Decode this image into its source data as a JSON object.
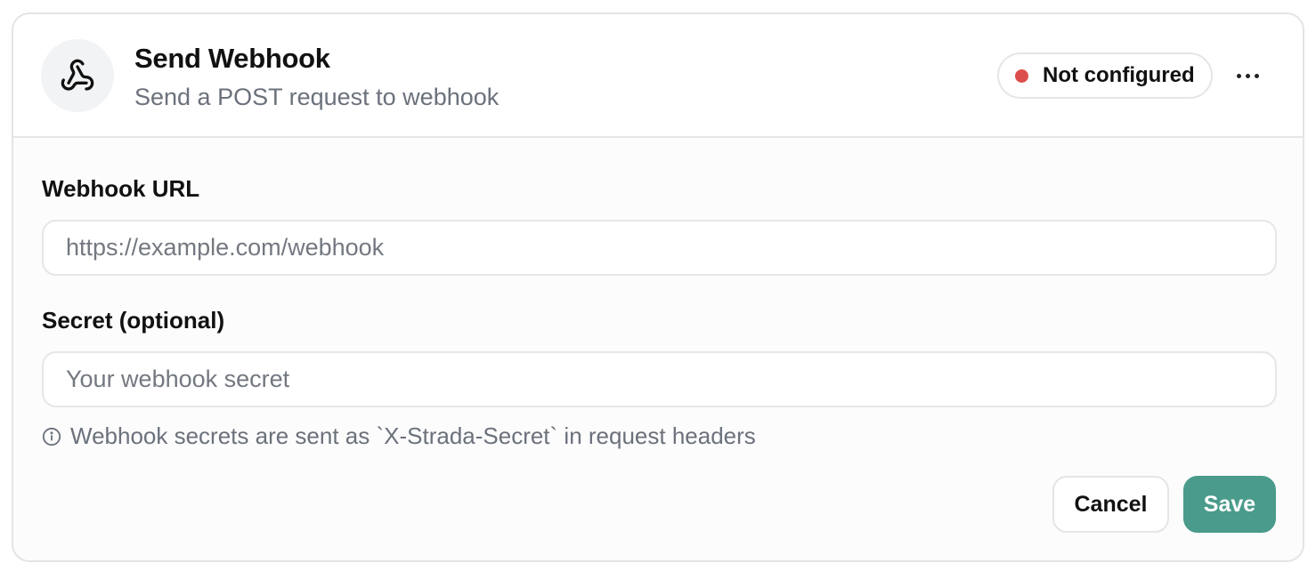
{
  "header": {
    "icon": "webhook-icon",
    "title": "Send Webhook",
    "subtitle": "Send a POST request to webhook",
    "status": {
      "label": "Not configured",
      "color": "#dc4e4e"
    },
    "more_icon": "more-horizontal-icon"
  },
  "form": {
    "url_field": {
      "label": "Webhook URL",
      "value": "",
      "placeholder": "https://example.com/webhook"
    },
    "secret_field": {
      "label": "Secret (optional)",
      "value": "",
      "placeholder": "Your webhook secret"
    },
    "hint": {
      "icon": "info-icon",
      "text": "Webhook secrets are sent as `X-Strada-Secret` in request headers"
    }
  },
  "actions": {
    "cancel_label": "Cancel",
    "save_label": "Save",
    "save_color": "#4a9b8b"
  }
}
